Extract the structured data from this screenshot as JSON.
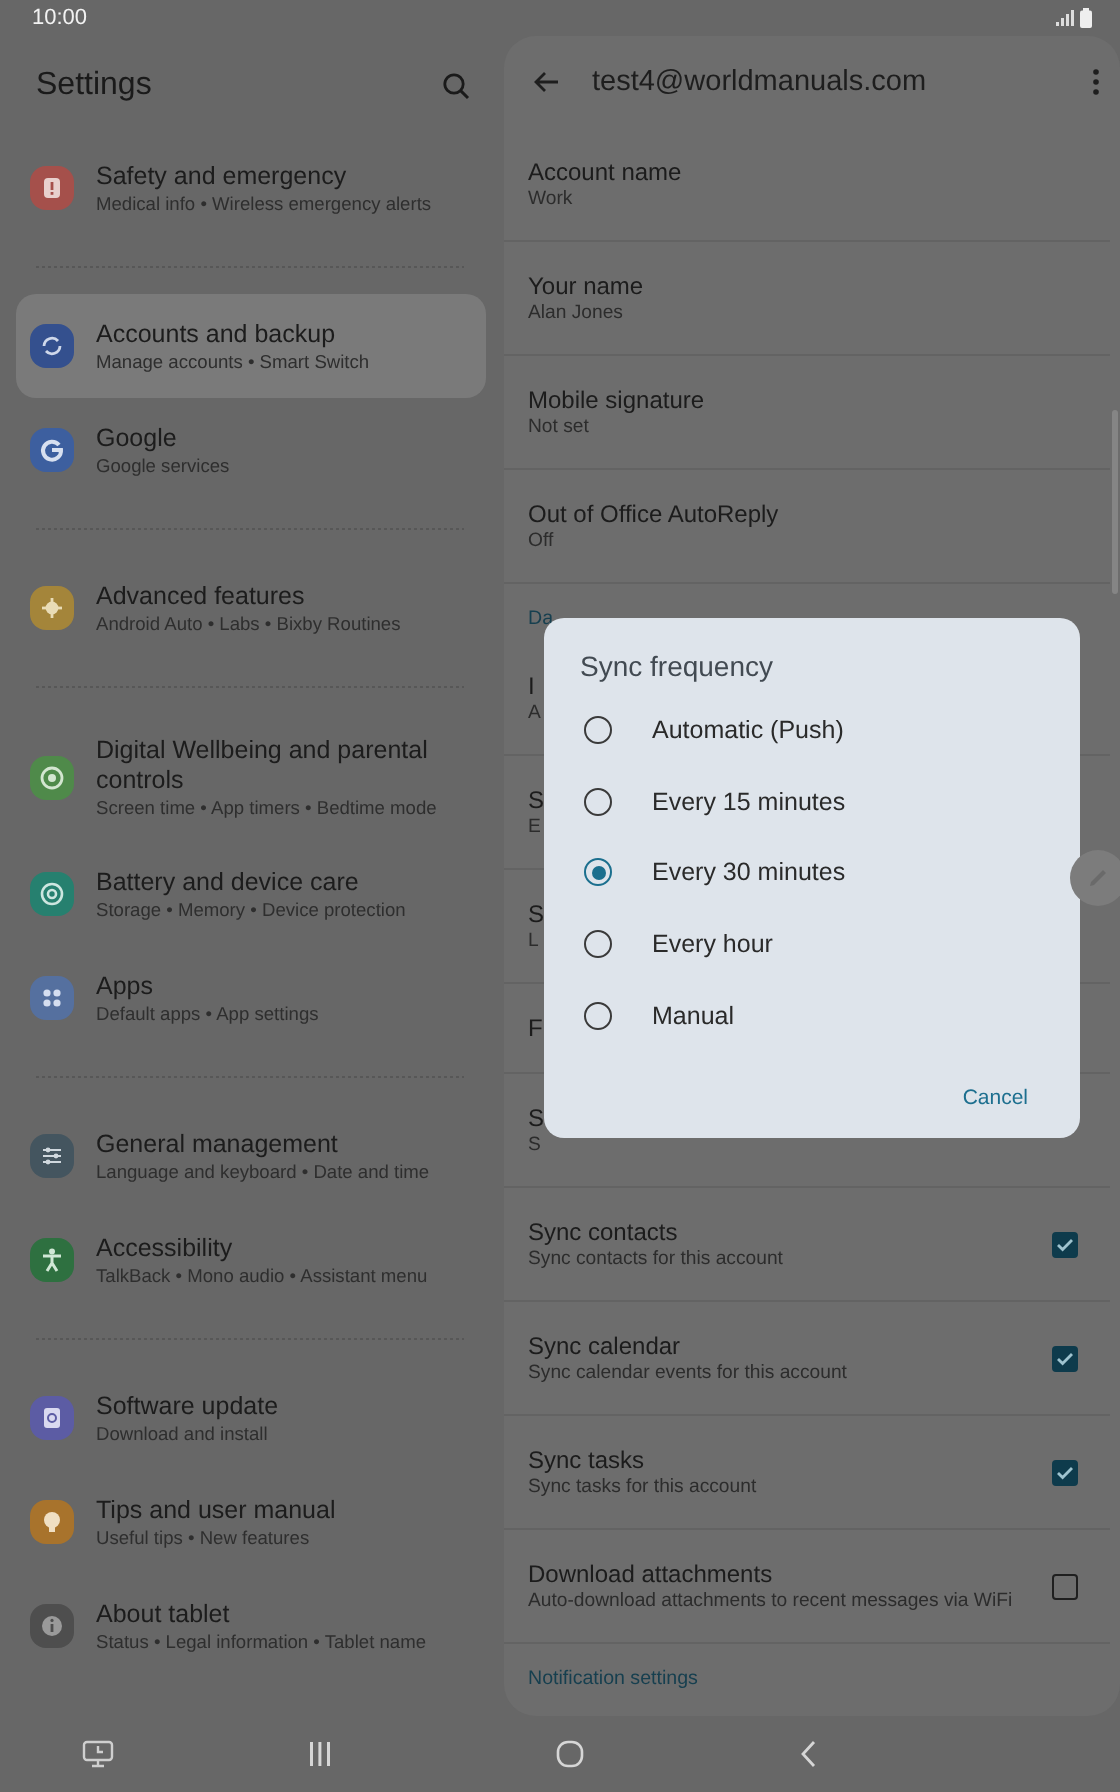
{
  "status_bar": {
    "time": "10:00"
  },
  "settings": {
    "title": "Settings",
    "sections": [
      [
        {
          "title": "Safety and emergency",
          "subtitle": "Medical info  •  Wireless emergency alerts",
          "color": "#a5504b",
          "selected": false
        }
      ],
      [
        {
          "title": "Accounts and backup",
          "subtitle": "Manage accounts  •  Smart Switch",
          "color": "#34508e",
          "selected": true
        },
        {
          "title": "Google",
          "subtitle": "Google services",
          "color": "#3d5f9f",
          "selected": false
        }
      ],
      [
        {
          "title": "Advanced features",
          "subtitle": "Android Auto  •  Labs  •  Bixby Routines",
          "color": "#a4853a",
          "selected": false
        }
      ],
      [
        {
          "title": "Digital Wellbeing and parental controls",
          "subtitle": "Screen time  •  App timers  •  Bedtime mode",
          "color": "#4f8a4a",
          "selected": false
        },
        {
          "title": "Battery and device care",
          "subtitle": "Storage  •  Memory  •  Device protection",
          "color": "#26806f",
          "selected": false
        },
        {
          "title": "Apps",
          "subtitle": "Default apps  •  App settings",
          "color": "#55709f",
          "selected": false
        }
      ],
      [
        {
          "title": "General management",
          "subtitle": "Language and keyboard  •  Date and time",
          "color": "#44555f",
          "selected": false
        },
        {
          "title": "Accessibility",
          "subtitle": "TalkBack  •  Mono audio  •  Assistant menu",
          "color": "#2e7040",
          "selected": false
        }
      ],
      [
        {
          "title": "Software update",
          "subtitle": "Download and install",
          "color": "#5c5ca4",
          "selected": false
        },
        {
          "title": "Tips and user manual",
          "subtitle": "Useful tips  •  New features",
          "color": "#a8732c",
          "selected": false
        },
        {
          "title": "About tablet",
          "subtitle": "Status  •  Legal information  •  Tablet name",
          "color": "#4e4e4e",
          "selected": false
        }
      ]
    ]
  },
  "account": {
    "title": "test4@worldmanuals.com",
    "rows": [
      {
        "kind": "setting",
        "title": "Account name",
        "subtitle": "Work"
      },
      {
        "kind": "setting",
        "title": "Your name",
        "subtitle": "Alan Jones"
      },
      {
        "kind": "setting",
        "title": "Mobile signature",
        "subtitle": "Not set"
      },
      {
        "kind": "setting",
        "title": "Out of Office AutoReply",
        "subtitle": "Off"
      },
      {
        "kind": "header",
        "title": "Da"
      },
      {
        "kind": "setting",
        "title": "I",
        "subtitle": "A"
      },
      {
        "kind": "setting",
        "title": "S",
        "subtitle": "E"
      },
      {
        "kind": "setting",
        "title": "S",
        "subtitle": "L"
      },
      {
        "kind": "setting",
        "title": "F"
      },
      {
        "kind": "setting",
        "title": "S",
        "subtitle": "S"
      },
      {
        "kind": "check",
        "title": "Sync contacts",
        "subtitle": "Sync contacts for this account",
        "checked": true
      },
      {
        "kind": "check",
        "title": "Sync calendar",
        "subtitle": "Sync calendar events for this account",
        "checked": true
      },
      {
        "kind": "check",
        "title": "Sync tasks",
        "subtitle": "Sync tasks for this account",
        "checked": true
      },
      {
        "kind": "check",
        "title": "Download attachments",
        "subtitle": "Auto-download attachments to recent messages via WiFi",
        "checked": false
      },
      {
        "kind": "header",
        "title": "Notification settings"
      }
    ]
  },
  "dialog": {
    "title": "Sync frequency",
    "options": [
      {
        "label": "Automatic (Push)",
        "selected": false
      },
      {
        "label": "Every 15 minutes",
        "selected": false
      },
      {
        "label": "Every 30 minutes",
        "selected": true
      },
      {
        "label": "Every hour",
        "selected": false
      },
      {
        "label": "Manual",
        "selected": false
      }
    ],
    "button": "Cancel"
  }
}
